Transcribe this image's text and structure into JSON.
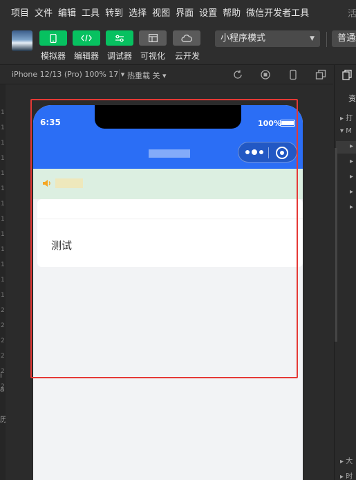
{
  "menu": {
    "items": [
      "项目",
      "文件",
      "编辑",
      "工具",
      "转到",
      "选择",
      "视图",
      "界面",
      "设置",
      "帮助",
      "微信开发者工具"
    ],
    "trailing": "活"
  },
  "toolbar": {
    "buttons": [
      {
        "label": "模拟器",
        "icon": "phone-icon"
      },
      {
        "label": "编辑器",
        "icon": "code-icon"
      },
      {
        "label": "调试器",
        "icon": "sliders-icon"
      },
      {
        "label": "可视化",
        "icon": "layout-icon"
      },
      {
        "label": "云开发",
        "icon": "cloud-icon"
      }
    ],
    "mode_select": "小程序模式",
    "compile_select": "普通编"
  },
  "simbar": {
    "device": "iPhone 12/13 (Pro) 100% 17 ▾",
    "hot_reload": "热重载 关 ▾"
  },
  "gutter": {
    "numbers": [
      "1",
      "1",
      "1",
      "1",
      "1",
      "1",
      "1",
      "1",
      "1",
      "1",
      "1",
      "1",
      "1",
      "2",
      "2",
      "2",
      "2",
      "2",
      "2"
    ]
  },
  "left_fragments": [
    "i",
    "a",
    "历"
  ],
  "phone": {
    "status_time": "6:35",
    "battery": "100%",
    "card_title": "测试"
  },
  "right_panel": {
    "tab_label": "资",
    "rows": [
      "▸ 打",
      "▾ M",
      "▸",
      "▸",
      "▸",
      "▸",
      "▸"
    ],
    "bottom_rows": [
      "▸ 大",
      "▸ 时"
    ]
  },
  "colors": {
    "nav_blue": "#2b6ef5",
    "accent_green": "#07c160",
    "highlight_red": "#e53935",
    "notice_bg": "#dcefe1"
  }
}
